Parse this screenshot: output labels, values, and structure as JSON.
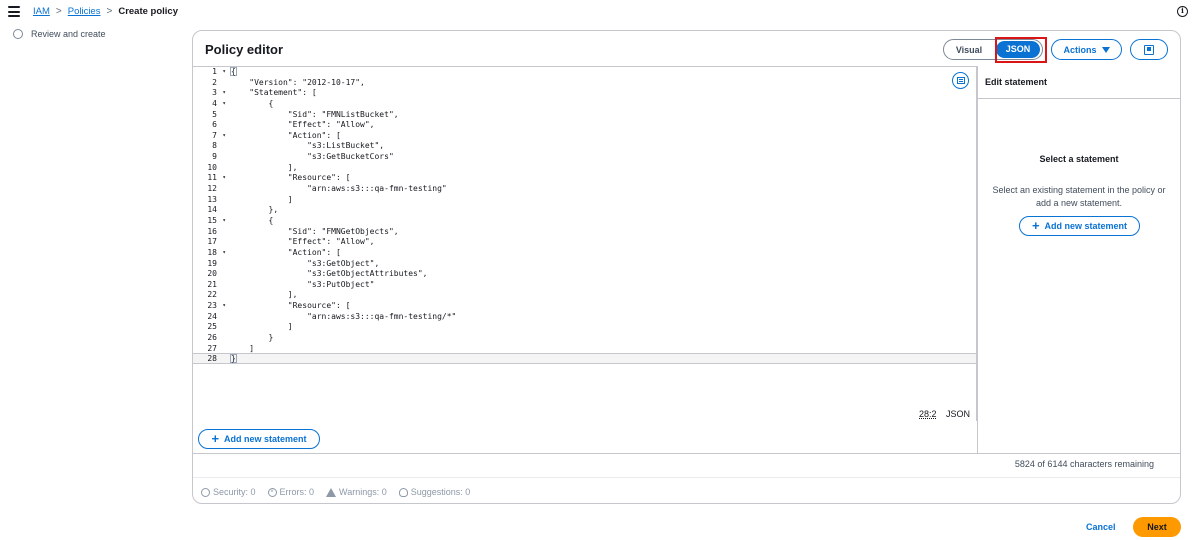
{
  "topbar": {
    "breadcrumbs": [
      "IAM",
      "Policies"
    ],
    "current": "Create policy",
    "separator": ">",
    "info_glyph": "i"
  },
  "steps": {
    "review": "Review and create"
  },
  "editor_panel": {
    "title": "Policy editor",
    "mode_visual": "Visual",
    "mode_json": "JSON",
    "actions_label": "Actions",
    "cursor_position": "28:2",
    "language": "JSON",
    "add_statement_label": "Add new statement",
    "line_numbers": [
      "1",
      "2",
      "3",
      "4",
      "5",
      "6",
      "7",
      "8",
      "9",
      "10",
      "11",
      "12",
      "13",
      "14",
      "15",
      "16",
      "17",
      "18",
      "19",
      "20",
      "21",
      "22",
      "23",
      "24",
      "25",
      "26",
      "27",
      "28"
    ],
    "fold_markers": [
      "▾",
      "",
      "▾",
      "▾",
      "",
      "",
      "▾",
      "",
      "",
      "",
      "▾",
      "",
      "",
      "",
      "▾",
      "",
      "",
      "▾",
      "",
      "",
      "",
      "",
      "▾",
      "",
      "",
      "",
      "",
      ""
    ],
    "code_lines": [
      "{",
      "    \"Version\": \"2012-10-17\",",
      "    \"Statement\": [",
      "        {",
      "            \"Sid\": \"FMNListBucket\",",
      "            \"Effect\": \"Allow\",",
      "            \"Action\": [",
      "                \"s3:ListBucket\",",
      "                \"s3:GetBucketCors\"",
      "            ],",
      "            \"Resource\": [",
      "                \"arn:aws:s3:::qa-fmn-testing\"",
      "            ]",
      "        },",
      "        {",
      "            \"Sid\": \"FMNGetObjects\",",
      "            \"Effect\": \"Allow\",",
      "            \"Action\": [",
      "                \"s3:GetObject\",",
      "                \"s3:GetObjectAttributes\",",
      "                \"s3:PutObject\"",
      "            ],",
      "            \"Resource\": [",
      "                \"arn:aws:s3:::qa-fmn-testing/*\"",
      "            ]",
      "        }",
      "    ]",
      "}"
    ],
    "characters_remaining": "5824 of 6144 characters remaining"
  },
  "statement_panel": {
    "title": "Edit statement",
    "empty_title": "Select a statement",
    "empty_description": "Select an existing statement in the policy or add a new statement.",
    "add_statement_label": "Add new statement"
  },
  "validation": {
    "security": "Security: 0",
    "errors": "Errors: 0",
    "warnings": "Warnings: 0",
    "suggestions": "Suggestions: 0"
  },
  "footer": {
    "cancel": "Cancel",
    "next": "Next"
  },
  "icons": [
    "menu-icon",
    "info-icon",
    "chevron-right-icon",
    "caret-down-icon",
    "split-panel-icon",
    "editor-settings-icon",
    "plus-icon",
    "shield-icon",
    "error-icon",
    "warning-icon",
    "lightbulb-icon"
  ],
  "colors": {
    "accent": "#0972d3",
    "primary_button": "#ff9900",
    "highlight": "#d91515"
  }
}
